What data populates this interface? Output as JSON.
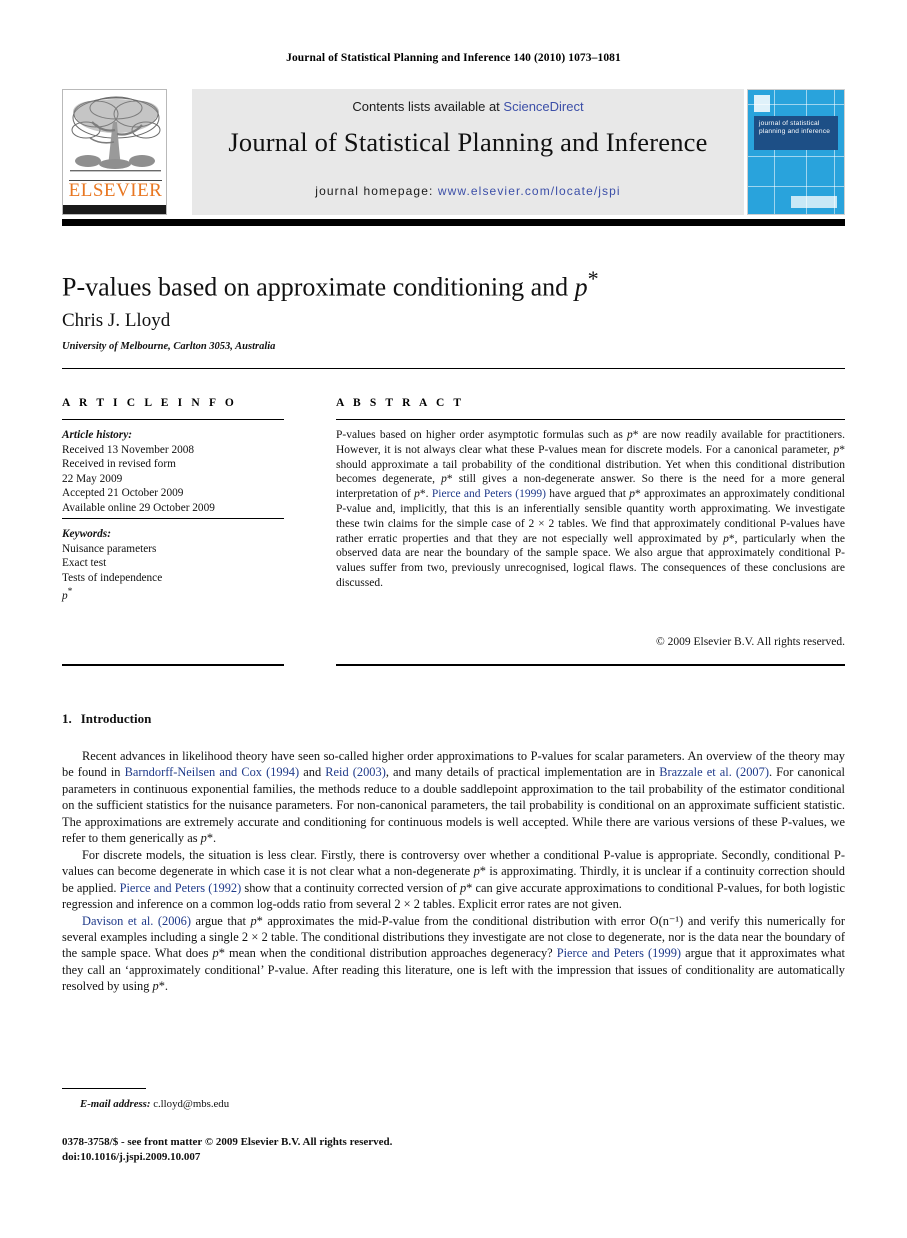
{
  "running_head": "Journal of Statistical Planning and Inference 140 (2010) 1073–1081",
  "masthead": {
    "publisher_logo_word": "ELSEVIER",
    "contents_prefix": "Contents lists available at ",
    "contents_link": "ScienceDirect",
    "journal_title": "Journal of Statistical Planning and Inference",
    "homepage_prefix": "journal homepage: ",
    "homepage_url": "www.elsevier.com/locate/jspi",
    "cover_caption": "journal of statistical planning and inference"
  },
  "colors": {
    "link_blue": "#3c4fa8",
    "ref_blue": "#1f3a8a",
    "elsevier_orange": "#e87722",
    "masthead_grey": "#e8e8e8",
    "cover_blue": "#29a3dc",
    "cover_band_blue": "#1d4f86"
  },
  "article": {
    "title": "P-values based on approximate conditioning and p*",
    "title_plain": "P-values based on approximate conditioning and ",
    "title_math": "p",
    "author": "Chris J. Lloyd",
    "affiliation": "University of Melbourne, Carlton 3053, Australia"
  },
  "info": {
    "heading": "A R T I C L E   I N F O",
    "history_label": "Article history:",
    "history": [
      "Received 13 November 2008",
      "Received in revised form",
      "22 May 2009",
      "Accepted 21 October 2009",
      "Available online 29 October 2009"
    ],
    "keywords_label": "Keywords:",
    "keywords": [
      "Nuisance parameters",
      "Exact test",
      "Tests of independence",
      "p*"
    ]
  },
  "abstract": {
    "heading": "A B S T R A C T",
    "paragraph_parts": [
      {
        "t": "P-values based on higher order asymptotic formulas such as ",
        "k": "plain"
      },
      {
        "t": "p",
        "k": "math"
      },
      {
        "t": "* are now readily available for practitioners. However, it is not always clear what these P-values mean for discrete models. For a canonical parameter, ",
        "k": "plain"
      },
      {
        "t": "p",
        "k": "math"
      },
      {
        "t": "* should approximate a tail probability of the conditional distribution. Yet when this conditional distribution becomes degenerate, ",
        "k": "plain"
      },
      {
        "t": "p",
        "k": "math"
      },
      {
        "t": "* still gives a non-degenerate answer. So there is the need for a more general interpretation of ",
        "k": "plain"
      },
      {
        "t": "p",
        "k": "math"
      },
      {
        "t": "*. ",
        "k": "plain"
      },
      {
        "t": "Pierce and Peters (1999)",
        "k": "link"
      },
      {
        "t": " have argued that ",
        "k": "plain"
      },
      {
        "t": "p",
        "k": "math"
      },
      {
        "t": "* approximates an approximately conditional P-value and, implicitly, that this is an inferentially sensible quantity worth approximating. We investigate these twin claims for the simple case of 2 × 2 tables. We find that approximately conditional P-values have rather erratic properties and that they are not especially well approximated by ",
        "k": "plain"
      },
      {
        "t": "p",
        "k": "math"
      },
      {
        "t": "*, particularly when the observed data are near the boundary of the sample space. We also argue that approximately conditional P-values suffer from two, previously unrecognised, logical flaws. The consequences of these conclusions are discussed.",
        "k": "plain"
      }
    ],
    "copyright": "© 2009 Elsevier B.V. All rights reserved."
  },
  "body": {
    "section_number": "1.",
    "section_title": "Introduction",
    "paragraphs": [
      [
        {
          "t": "Recent advances in likelihood theory have seen so-called higher order approximations to P-values for scalar parameters. An overview of the theory may be found in ",
          "k": "plain"
        },
        {
          "t": "Barndorff-Neilsen and Cox (1994)",
          "k": "link"
        },
        {
          "t": " and ",
          "k": "plain"
        },
        {
          "t": "Reid (2003)",
          "k": "link"
        },
        {
          "t": ", and many details of practical implementation are in ",
          "k": "plain"
        },
        {
          "t": "Brazzale et al. (2007)",
          "k": "link"
        },
        {
          "t": ". For canonical parameters in continuous exponential families, the methods reduce to a double saddlepoint approximation to the tail probability of the estimator conditional on the sufficient statistics for the nuisance parameters. For non-canonical parameters, the tail probability is conditional on an approximate sufficient statistic. The approximations are extremely accurate and conditioning for continuous models is well accepted. While there are various versions of these P-values, we refer to them generically as ",
          "k": "plain"
        },
        {
          "t": "p",
          "k": "math"
        },
        {
          "t": "*.",
          "k": "plain"
        }
      ],
      [
        {
          "t": "For discrete models, the situation is less clear. Firstly, there is controversy over whether a conditional P-value is appropriate. Secondly, conditional P-values can become degenerate in which case it is not clear what a non-degenerate ",
          "k": "plain"
        },
        {
          "t": "p",
          "k": "math"
        },
        {
          "t": "* is approximating. Thirdly, it is unclear if a continuity correction should be applied. ",
          "k": "plain"
        },
        {
          "t": "Pierce and Peters (1992)",
          "k": "link"
        },
        {
          "t": " show that a continuity corrected version of ",
          "k": "plain"
        },
        {
          "t": "p",
          "k": "math"
        },
        {
          "t": "* can give accurate approximations to conditional P-values, for both logistic regression and inference on a common log-odds ratio from several 2 × 2 tables. Explicit error rates are not given.",
          "k": "plain"
        }
      ],
      [
        {
          "t": "Davison et al. (2006)",
          "k": "link"
        },
        {
          "t": " argue that ",
          "k": "plain"
        },
        {
          "t": "p",
          "k": "math"
        },
        {
          "t": "* approximates the mid-P-value from the conditional distribution with error O(n⁻¹) and verify this numerically for several examples including a single 2 × 2 table. The conditional distributions they investigate are not close to degenerate, nor is the data near the boundary of the sample space. What does ",
          "k": "plain"
        },
        {
          "t": "p",
          "k": "math"
        },
        {
          "t": "* mean when the conditional distribution approaches degeneracy? ",
          "k": "plain"
        },
        {
          "t": "Pierce and Peters (1999)",
          "k": "link"
        },
        {
          "t": " argue that it approximates what they call an ‘approximately conditional’ P-value. After reading this literature, one is left with the impression that issues of conditionality are automatically resolved by using ",
          "k": "plain"
        },
        {
          "t": "p",
          "k": "math"
        },
        {
          "t": "*.",
          "k": "plain"
        }
      ]
    ]
  },
  "footer": {
    "email_label": "E-mail address:",
    "email": "c.lloyd@mbs.edu",
    "issn_line": "0378-3758/$ - see front matter © 2009 Elsevier B.V. All rights reserved.",
    "doi_line": "doi:10.1016/j.jspi.2009.10.007"
  }
}
